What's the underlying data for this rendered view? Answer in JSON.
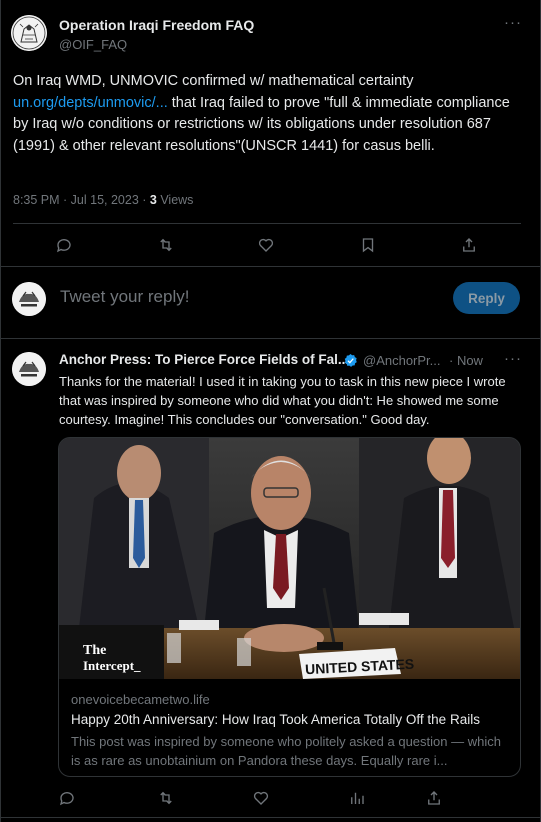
{
  "main_tweet": {
    "author_name": "Operation Iraqi Freedom FAQ",
    "author_handle": "@OIF_FAQ",
    "text_before_link": "On Iraq WMD, UNMOVIC confirmed w/ mathematical certainty ",
    "link_text": "un.org/depts/unmovic/...",
    "text_after_link": " that Iraq failed to prove \"full & immediate compliance by Iraq w/o conditions or restrictions w/ its obligations under resolution 687 (1991) & other relevant resolutions\"(UNSCR 1441) for casus belli.",
    "timestamp": "8:35 PM · Jul 15, 2023 · ",
    "views_count": "3",
    "views_label": " Views",
    "more_label": "···"
  },
  "reply_composer": {
    "placeholder": "Tweet your reply!",
    "button_label": "Reply"
  },
  "reply_tweet": {
    "author_name": "Anchor Press: To Pierce Force Fields of Fal...",
    "author_handle": "@AnchorPr...",
    "time": "· Now",
    "more_label": "···",
    "text": "Thanks for the material! I used it in taking you to task in this new piece I wrote that was inspired by someone who did what you didn't: He showed me some courtesy. Imagine! This concludes our \"conversation.\" Good day.",
    "card": {
      "image_logo": "The Intercept_",
      "image_placard": "UNITED STATES",
      "domain": "onevoicebecametwo.life",
      "title": "Happy 20th Anniversary: How Iraq Took America Totally Off the Rails",
      "description": "This post was inspired by someone who politely asked a question — which is as rare as unobtainium on Pandora these days. Equally rare i..."
    }
  },
  "colors": {
    "background": "#000000",
    "text": "#e7e9ea",
    "muted": "#71767b",
    "link": "#1d9bf0",
    "border": "#2f3336",
    "reply_button": "#0e5184"
  },
  "icons": [
    "reply-icon",
    "retweet-icon",
    "like-icon",
    "bookmark-icon",
    "share-icon",
    "analytics-icon",
    "verified-badge-icon"
  ]
}
